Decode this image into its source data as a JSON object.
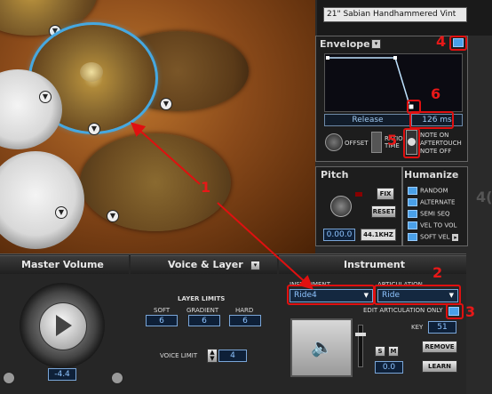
{
  "preset_name": "21\" Sabian Handhammered Vint",
  "envelope": {
    "title": "Envelope",
    "mode_label": "Release",
    "time_value": "126 ms",
    "offset_label": "OFFSET",
    "ratio_label": "RATIO",
    "ratio_label2": "TIME",
    "note_on": "NOTE ON",
    "aftertouch": "AFTERTOUCH",
    "note_off": "NOTE OFF"
  },
  "pitch": {
    "title": "Pitch",
    "fix": "FIX",
    "reset": "RESET",
    "value": "0.00.0",
    "rate": "44.1KHZ"
  },
  "humanize": {
    "title": "Humanize",
    "items": [
      "RANDOM",
      "ALTERNATE",
      "SEMI SEQ",
      "VEL TO VOL",
      "SOFT VEL"
    ]
  },
  "master": {
    "title": "Master Volume",
    "value": "-4.4"
  },
  "voice_layer": {
    "title": "Voice & Layer",
    "limits_title": "LAYER LIMITS",
    "soft": "SOFT",
    "gradient": "GRADIENT",
    "hard": "HARD",
    "soft_v": "6",
    "gradient_v": "6",
    "hard_v": "6",
    "voice_limit_label": "VOICE LIMIT",
    "voice_limit": "4"
  },
  "instrument": {
    "title": "Instrument",
    "inst_label": "INSTRUMENT",
    "inst_value": "Ride4",
    "artic_label": "ARTICULATION",
    "artic_value": "Ride",
    "edit_only": "EDIT ARTICULATION ONLY",
    "key_label": "KEY",
    "key_value": "51",
    "s": "S",
    "m": "M",
    "remove": "REMOVE",
    "learn": "LEARN",
    "level": "0.0"
  },
  "annotations": {
    "n1": "1",
    "n2": "2",
    "n3": "3",
    "n4": "4",
    "n5": "5",
    "n6": "6"
  },
  "edge_text": "4("
}
